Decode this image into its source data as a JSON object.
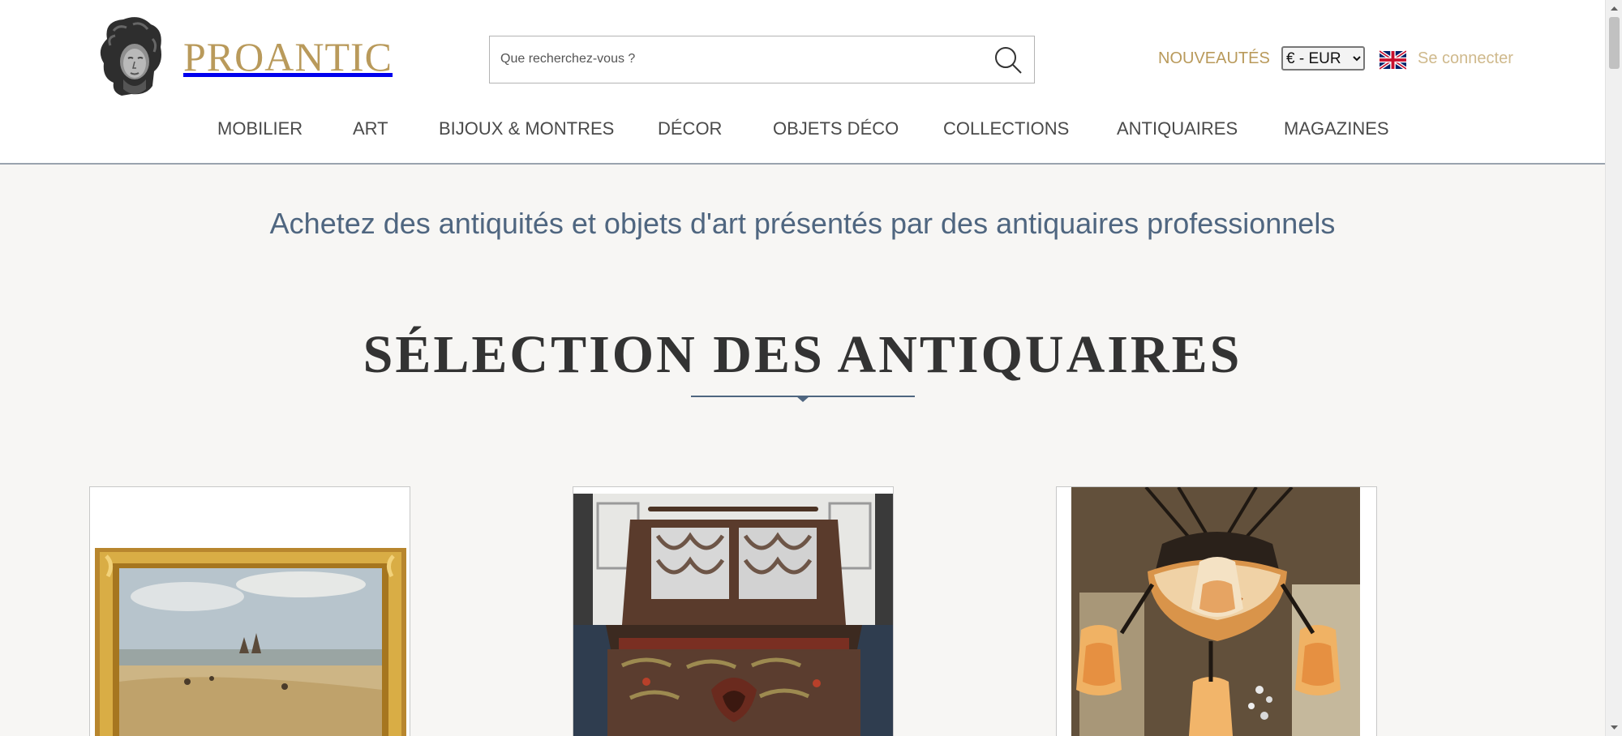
{
  "header": {
    "logo_text": "PROANTIC",
    "search_placeholder": "Que recherchez-vous ?",
    "nouveautes": "NOUVEAUTÉS",
    "currency": {
      "selected": "€ - EUR",
      "options": [
        "€ - EUR"
      ]
    },
    "login": "Se connecter"
  },
  "nav": {
    "items": [
      {
        "label": "MOBILIER"
      },
      {
        "label": "ART"
      },
      {
        "label": "BIJOUX & MONTRES"
      },
      {
        "label": "DÉCOR"
      },
      {
        "label": "OBJETS DÉCO"
      },
      {
        "label": "COLLECTIONS"
      },
      {
        "label": "ANTIQUAIRES"
      },
      {
        "label": "MAGAZINES"
      }
    ]
  },
  "main": {
    "tagline": "Achetez des antiquités et objets d'art présentés par des antiquaires professionnels",
    "section_title": "SÉLECTION DES ANTIQUAIRES"
  },
  "products": [
    {
      "image": "gilt-framed-beach-landscape-painting"
    },
    {
      "image": "carved-painted-wooden-chest"
    },
    {
      "image": "art-deco-glass-chandelier"
    }
  ],
  "colors": {
    "brand_gold": "#b99a5b",
    "login_gold": "#cfb98c",
    "tagline_blue": "#4f6680",
    "background": "#f7f6f4"
  }
}
